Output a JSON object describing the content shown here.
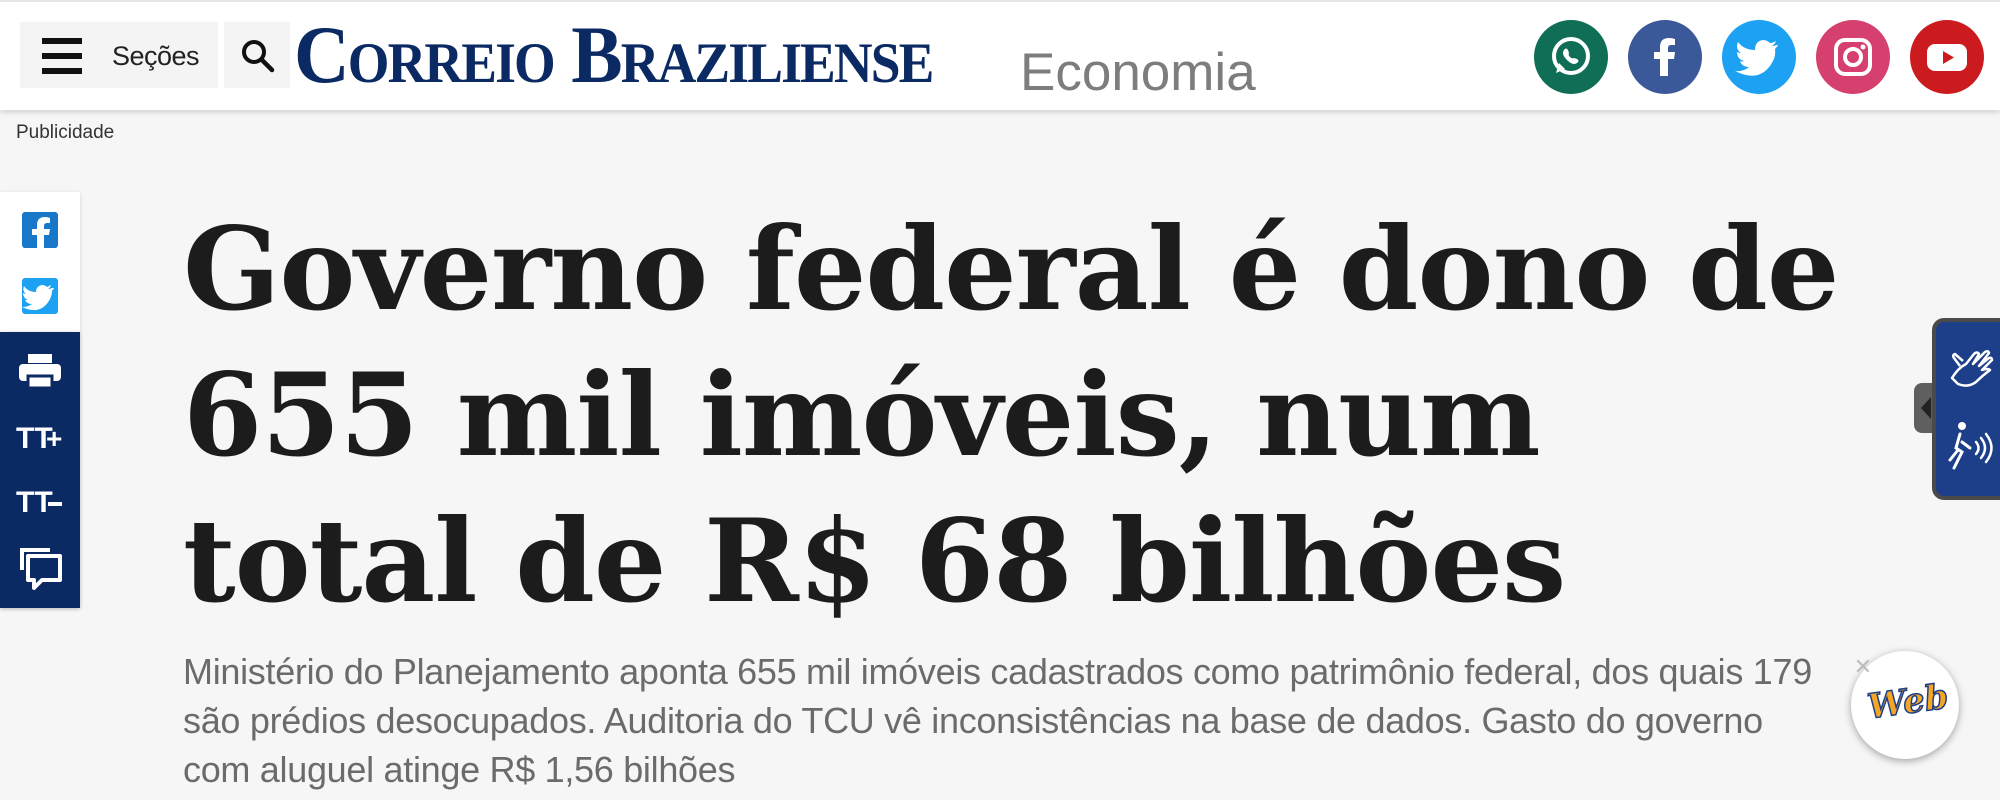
{
  "header": {
    "menu_label": "Seções",
    "logo_text_1": "Correio",
    "logo_text_2": "Braziliense",
    "section": "Economia",
    "social": [
      {
        "name": "whatsapp-icon",
        "color": "#0f6e55"
      },
      {
        "name": "facebook-icon",
        "color": "#3b5998"
      },
      {
        "name": "twitter-icon",
        "color": "#1da1f2"
      },
      {
        "name": "instagram-icon",
        "color": "#d6406f"
      },
      {
        "name": "youtube-icon",
        "color": "#cc1b1f"
      }
    ]
  },
  "ad": {
    "label": "Publicidade"
  },
  "share_rail": {
    "items": [
      "facebook-icon",
      "twitter-icon",
      "print-icon",
      "font-increase-icon",
      "font-decrease-icon",
      "comments-icon"
    ],
    "brand_color": "#0b2a63"
  },
  "article": {
    "headline": "Governo federal é dono de 655 mil imóveis, num total de R$ 68 bilhões",
    "lead": "Ministério do Planejamento aponta 655 mil imóveis cadastrados como patrimônio federal, dos quais 179 são prédios desocupados. Auditoria do TCU vê inconsistências na base de dados. Gasto do governo com aluguel atinge R$ 1,56 bilhões"
  },
  "accessibility": {
    "buttons": [
      "sign-language-icon",
      "audio-description-icon"
    ],
    "color": "#1d3f8a"
  },
  "chat": {
    "label": "Web",
    "close": "✕"
  }
}
